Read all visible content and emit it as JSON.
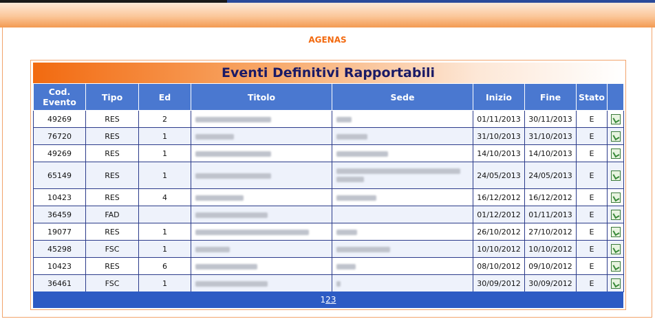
{
  "org": "AGENAS",
  "title": "Eventi Definitivi Rapportabili",
  "columns": [
    "Cod. Evento",
    "Tipo",
    "Ed",
    "Titolo",
    "Sede",
    "Inizio",
    "Fine",
    "Stato"
  ],
  "rows": [
    {
      "cod": "49269",
      "tipo": "RES",
      "ed": "2",
      "inizio": "01/11/2013",
      "fine": "30/11/2013",
      "stato": "E"
    },
    {
      "cod": "76720",
      "tipo": "RES",
      "ed": "1",
      "inizio": "31/10/2013",
      "fine": "31/10/2013",
      "stato": "E"
    },
    {
      "cod": "49269",
      "tipo": "RES",
      "ed": "1",
      "inizio": "14/10/2013",
      "fine": "14/10/2013",
      "stato": "E"
    },
    {
      "cod": "65149",
      "tipo": "RES",
      "ed": "1",
      "inizio": "24/05/2013",
      "fine": "24/05/2013",
      "stato": "E"
    },
    {
      "cod": "10423",
      "tipo": "RES",
      "ed": "4",
      "inizio": "16/12/2012",
      "fine": "16/12/2012",
      "stato": "E"
    },
    {
      "cod": "36459",
      "tipo": "FAD",
      "ed": "",
      "inizio": "01/12/2012",
      "fine": "01/11/2013",
      "stato": "E"
    },
    {
      "cod": "19077",
      "tipo": "RES",
      "ed": "1",
      "inizio": "26/10/2012",
      "fine": "27/10/2012",
      "stato": "E"
    },
    {
      "cod": "45298",
      "tipo": "FSC",
      "ed": "1",
      "inizio": "10/10/2012",
      "fine": "10/10/2012",
      "stato": "E"
    },
    {
      "cod": "10423",
      "tipo": "RES",
      "ed": "6",
      "inizio": "08/10/2012",
      "fine": "09/10/2012",
      "stato": "E"
    },
    {
      "cod": "36461",
      "tipo": "FSC",
      "ed": "1",
      "inizio": "30/09/2012",
      "fine": "30/09/2012",
      "stato": "E"
    }
  ],
  "pager": {
    "current": "1",
    "p2": "2",
    "p3": "3"
  }
}
